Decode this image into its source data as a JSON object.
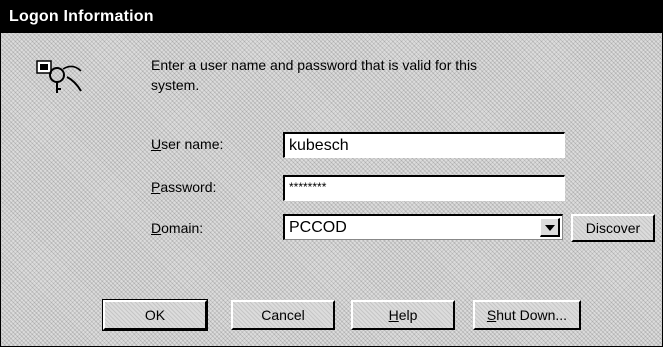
{
  "window": {
    "title": "Logon Information"
  },
  "message": "Enter a user name and password that is valid for this system.",
  "fields": {
    "username": {
      "label": "User name:",
      "value": "kubesch"
    },
    "password": {
      "label": "Password:",
      "value": "********"
    },
    "domain": {
      "label": "Domain:",
      "value": "PCCOD"
    }
  },
  "buttons": {
    "discover": "Discover",
    "ok": "OK",
    "cancel": "Cancel",
    "help": "Help",
    "shutdown": "Shut Down..."
  },
  "icons": {
    "logon": "key-user-icon",
    "dropdown": "chevron-down-icon"
  }
}
